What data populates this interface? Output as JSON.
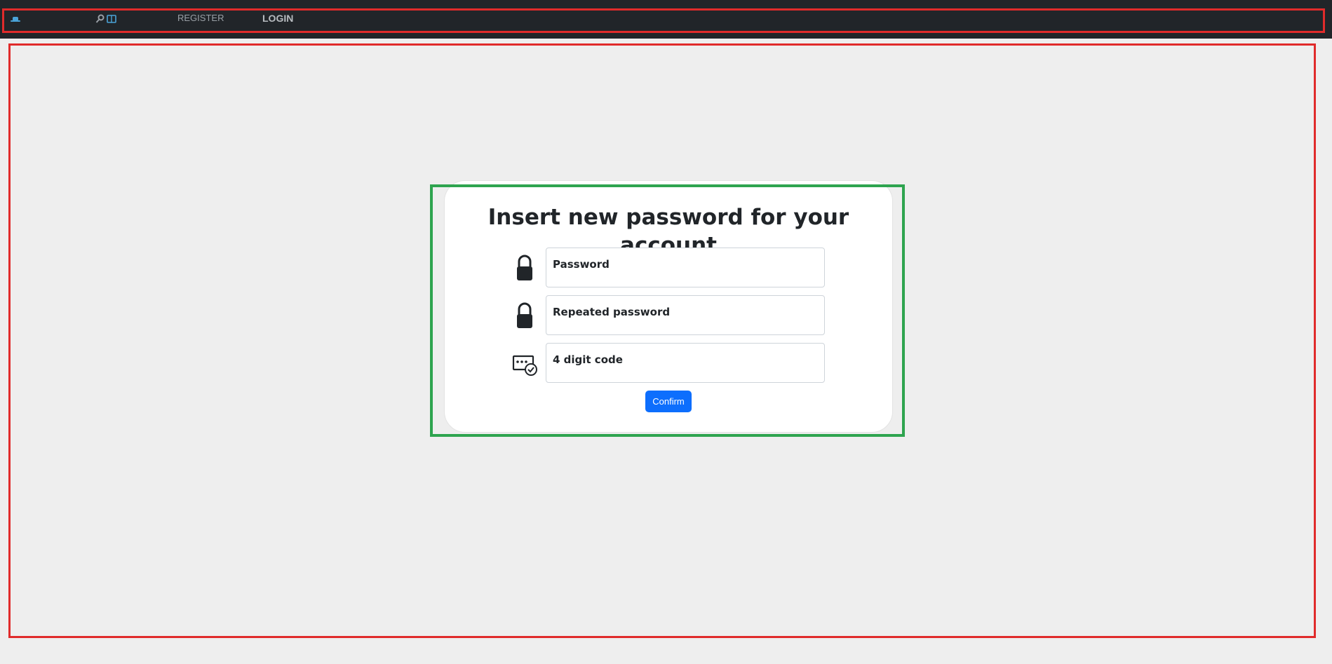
{
  "nav": {
    "home_icon": "hat-icon",
    "search_icon": "magnifier-icon",
    "book_icon": "book-icon",
    "register_label": "REGISTER",
    "login_label": "LOGIN"
  },
  "card": {
    "title": "Insert new password for your account",
    "fields": [
      {
        "icon": "lock-icon",
        "placeholder": "Password"
      },
      {
        "icon": "lock-icon",
        "placeholder": "Repeated password"
      },
      {
        "icon": "verification-code-icon",
        "placeholder": "4 digit code"
      }
    ],
    "confirm_label": "Confirm"
  },
  "colors": {
    "topbar": "#212529",
    "background": "#eeeeee",
    "primary": "#0d6efd",
    "frame_red": "#e02b2b",
    "frame_green": "#2ea44f"
  }
}
